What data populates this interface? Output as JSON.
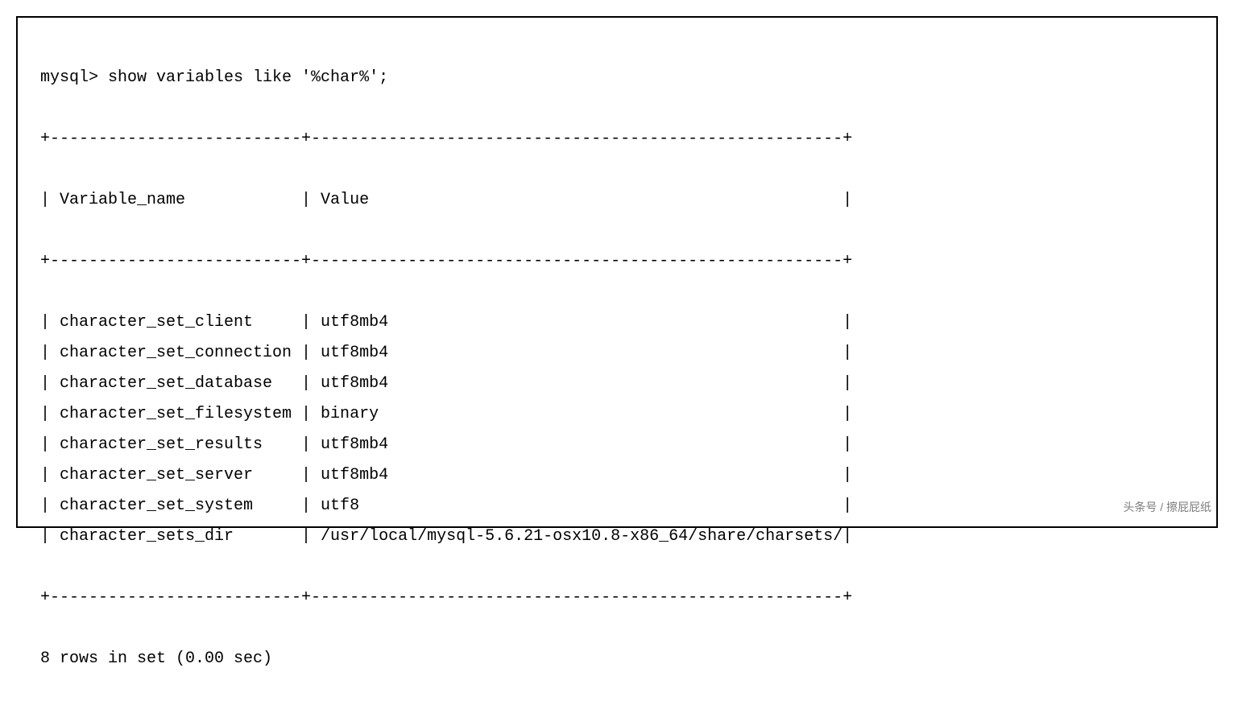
{
  "command": "mysql> show variables like '%char%';",
  "header": {
    "col1": "Variable_name",
    "col2": "Value"
  },
  "rows": [
    {
      "name": "character_set_client",
      "value": "utf8mb4"
    },
    {
      "name": "character_set_connection",
      "value": "utf8mb4"
    },
    {
      "name": "character_set_database",
      "value": "utf8mb4"
    },
    {
      "name": "character_set_filesystem",
      "value": "binary"
    },
    {
      "name": "character_set_results",
      "value": "utf8mb4"
    },
    {
      "name": "character_set_server",
      "value": "utf8mb4"
    },
    {
      "name": "character_set_system",
      "value": "utf8"
    },
    {
      "name": "character_sets_dir",
      "value": "/usr/local/mysql-5.6.21-osx10.8-x86_64/share/charsets/"
    }
  ],
  "footer": "8 rows in set (0.00 sec)",
  "col1_width": 26,
  "col2_width": 55,
  "watermark": "头条号 / 擦屁屁纸"
}
